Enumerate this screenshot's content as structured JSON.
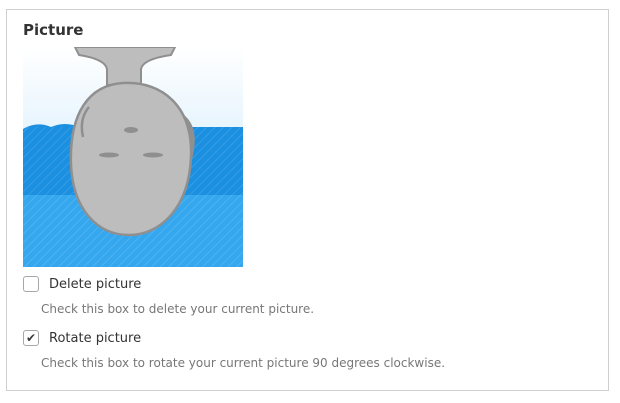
{
  "section": {
    "title": "Picture"
  },
  "avatar": {
    "icon": "default-user-avatar-rotated-icon",
    "colors": {
      "sky_light": "#e8f4fd",
      "sky_mid": "#bfe3fa",
      "wave_dark": "#1b8fe0",
      "wave_light": "#35a7ee",
      "face": "#bdbdbd",
      "outline": "#8f8f8f"
    }
  },
  "options": [
    {
      "label": "Delete picture",
      "description": "Check this box to delete your current picture.",
      "checked": false
    },
    {
      "label": "Rotate picture",
      "description": "Check this box to rotate your current picture 90 degrees clockwise.",
      "checked": true,
      "check_glyph": "✔"
    }
  ]
}
